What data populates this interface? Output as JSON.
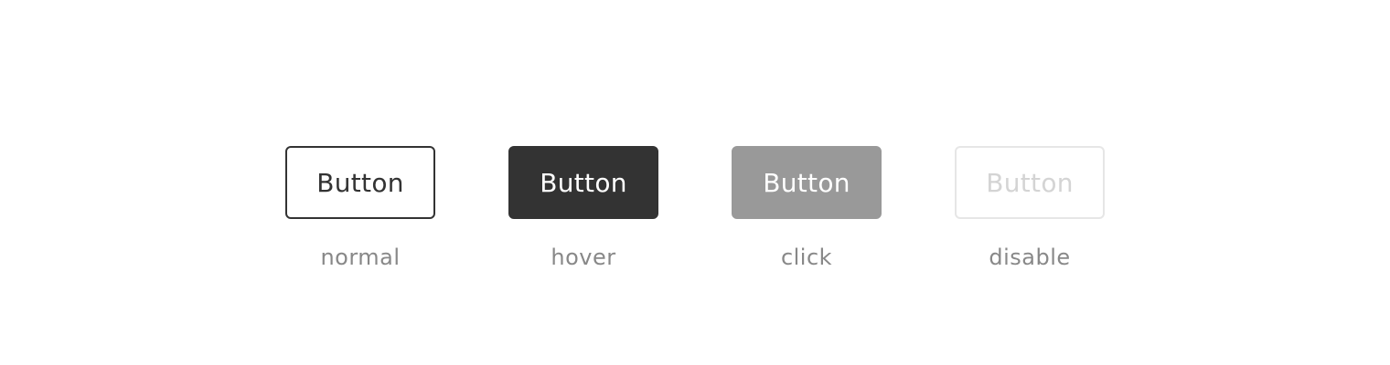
{
  "buttons": [
    {
      "label": "Button",
      "state": "normal"
    },
    {
      "label": "Button",
      "state": "hover"
    },
    {
      "label": "Button",
      "state": "click"
    },
    {
      "label": "Button",
      "state": "disable"
    }
  ],
  "colors": {
    "background": "#ffffff",
    "dark": "#333333",
    "pressed": "#999999",
    "disabled_border": "#e6e6e6",
    "disabled_text": "#d4d4d4",
    "caption": "#888888"
  }
}
